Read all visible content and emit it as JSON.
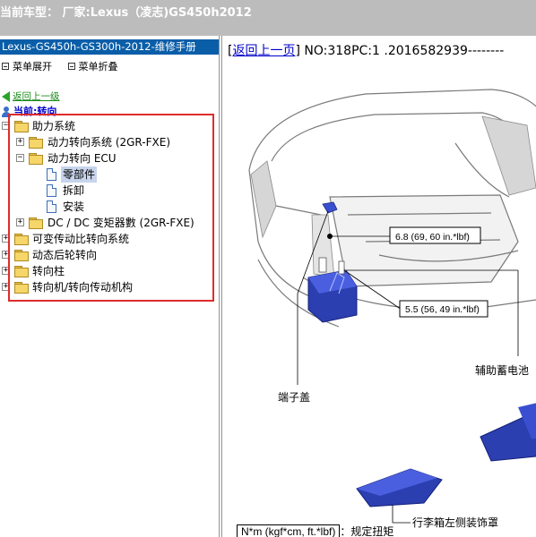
{
  "window": {
    "title": "当前车型： 厂家:Lexus（凌志)GS450h2012"
  },
  "sidebar": {
    "manual_title": "Lexus-GS450h-GS300h-2012-维修手册",
    "toolbar": {
      "expand_label": "菜单展开",
      "collapse_label": "菜单折叠"
    },
    "back_link": "返回上一级",
    "current_label": "当前:转向",
    "tree": [
      {
        "label": "助力系统",
        "expander": "−",
        "level": 0,
        "type": "folder"
      },
      {
        "label": "动力转向系统 (2GR-FXE)",
        "expander": "+",
        "level": 1,
        "type": "folder"
      },
      {
        "label": "动力转向 ECU",
        "expander": "−",
        "level": 1,
        "type": "folder"
      },
      {
        "label": "零部件",
        "expander": "",
        "level": 2,
        "type": "page",
        "selected": true
      },
      {
        "label": "拆卸",
        "expander": "",
        "level": 2,
        "type": "page"
      },
      {
        "label": "安装",
        "expander": "",
        "level": 2,
        "type": "page"
      },
      {
        "label": "DC / DC 变矩器數 (2GR-FXE)",
        "expander": "+",
        "level": 1,
        "type": "folder"
      },
      {
        "label": "可变传动比转向系统",
        "expander": "+",
        "level": 0,
        "type": "folder"
      },
      {
        "label": "动态后轮转向",
        "expander": "+",
        "level": 0,
        "type": "folder"
      },
      {
        "label": "转向柱",
        "expander": "+",
        "level": 0,
        "type": "folder"
      },
      {
        "label": "转向机/转向传动机构",
        "expander": "+",
        "level": 0,
        "type": "folder"
      }
    ]
  },
  "document": {
    "back_link": "返回上一页",
    "header_text": "NO:318PC:1 .2016582939--------",
    "callouts": {
      "torque1": "6.8 (69, 60 in.*lbf)",
      "torque2": "5.5 (56, 49 in.*lbf)",
      "battery": "辅助蓄电池",
      "terminal_cover": "端子盖",
      "trunk_trim": "行李箱左侧装饰罩"
    },
    "legend_unit": "N*m (kgf*cm, ft.*lbf)",
    "legend_desc": "：规定扭矩"
  },
  "colors": {
    "titlebar_bg": "#bcbcbc",
    "manual_title_bg": "#0a5ea8",
    "highlight_box": "#e02b2b",
    "part_blue": "#2c3fb0"
  }
}
